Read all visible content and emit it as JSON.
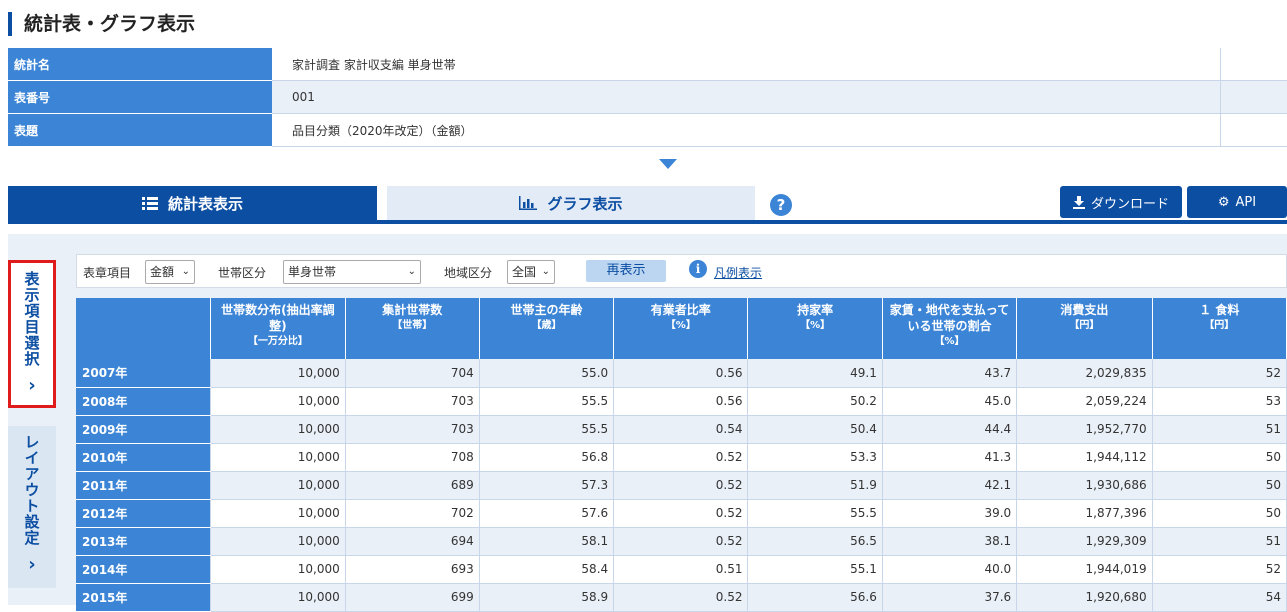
{
  "page": {
    "title": "統計表・グラフ表示"
  },
  "info": [
    {
      "label": "統計名",
      "value": "家計調査 家計収支編 単身世帯"
    },
    {
      "label": "表番号",
      "value": "001"
    },
    {
      "label": "表題",
      "value": "品目分類（2020年改定）（金額）"
    }
  ],
  "tabs": {
    "table": "統計表表示",
    "graph": "グラフ表示",
    "help": "?"
  },
  "actions": {
    "download": "ダウンロード",
    "api": "API"
  },
  "side": {
    "select_items": "表示項目選択",
    "layout": "レイアウト設定",
    "chevron": "›"
  },
  "filters": {
    "item_label": "表章項目",
    "item_value": "金額",
    "household_label": "世帯区分",
    "household_value": "単身世帯",
    "region_label": "地域区分",
    "region_value": "全国",
    "redisplay": "再表示",
    "legend": "凡例表示",
    "legend_icon": "i"
  },
  "table": {
    "headers": [
      {
        "name": "世帯数分布(抽出率調整)",
        "unit": "【一万分比】"
      },
      {
        "name": "集計世帯数",
        "unit": "【世帯】"
      },
      {
        "name": "世帯主の年齢",
        "unit": "【歳】"
      },
      {
        "name": "有業者比率",
        "unit": "【%】"
      },
      {
        "name": "持家率",
        "unit": "【%】"
      },
      {
        "name": "家賃・地代を支払っている世帯の割合",
        "unit": "【%】"
      },
      {
        "name": "消費支出",
        "unit": "【円】"
      },
      {
        "name": "１ 食料",
        "unit": "【円】"
      }
    ],
    "rows": [
      {
        "year": "2007年",
        "cells": [
          "10,000",
          "704",
          "55.0",
          "0.56",
          "49.1",
          "43.7",
          "2,029,835",
          "52"
        ]
      },
      {
        "year": "2008年",
        "cells": [
          "10,000",
          "703",
          "55.5",
          "0.56",
          "50.2",
          "45.0",
          "2,059,224",
          "53"
        ]
      },
      {
        "year": "2009年",
        "cells": [
          "10,000",
          "703",
          "55.5",
          "0.54",
          "50.4",
          "44.4",
          "1,952,770",
          "51"
        ]
      },
      {
        "year": "2010年",
        "cells": [
          "10,000",
          "708",
          "56.8",
          "0.52",
          "53.3",
          "41.3",
          "1,944,112",
          "50"
        ]
      },
      {
        "year": "2011年",
        "cells": [
          "10,000",
          "689",
          "57.3",
          "0.52",
          "51.9",
          "42.1",
          "1,930,686",
          "50"
        ]
      },
      {
        "year": "2012年",
        "cells": [
          "10,000",
          "702",
          "57.6",
          "0.52",
          "55.5",
          "39.0",
          "1,877,396",
          "50"
        ]
      },
      {
        "year": "2013年",
        "cells": [
          "10,000",
          "694",
          "58.1",
          "0.52",
          "56.5",
          "38.1",
          "1,929,309",
          "51"
        ]
      },
      {
        "year": "2014年",
        "cells": [
          "10,000",
          "693",
          "58.4",
          "0.51",
          "55.1",
          "40.0",
          "1,944,019",
          "52"
        ]
      },
      {
        "year": "2015年",
        "cells": [
          "10,000",
          "699",
          "58.9",
          "0.52",
          "56.6",
          "37.6",
          "1,920,680",
          "54"
        ]
      }
    ]
  },
  "colors": {
    "primary": "#0b4ea2",
    "header_blue": "#3c85d6",
    "row_alt": "#eaf0f8",
    "highlight_red": "#e01b1b"
  }
}
